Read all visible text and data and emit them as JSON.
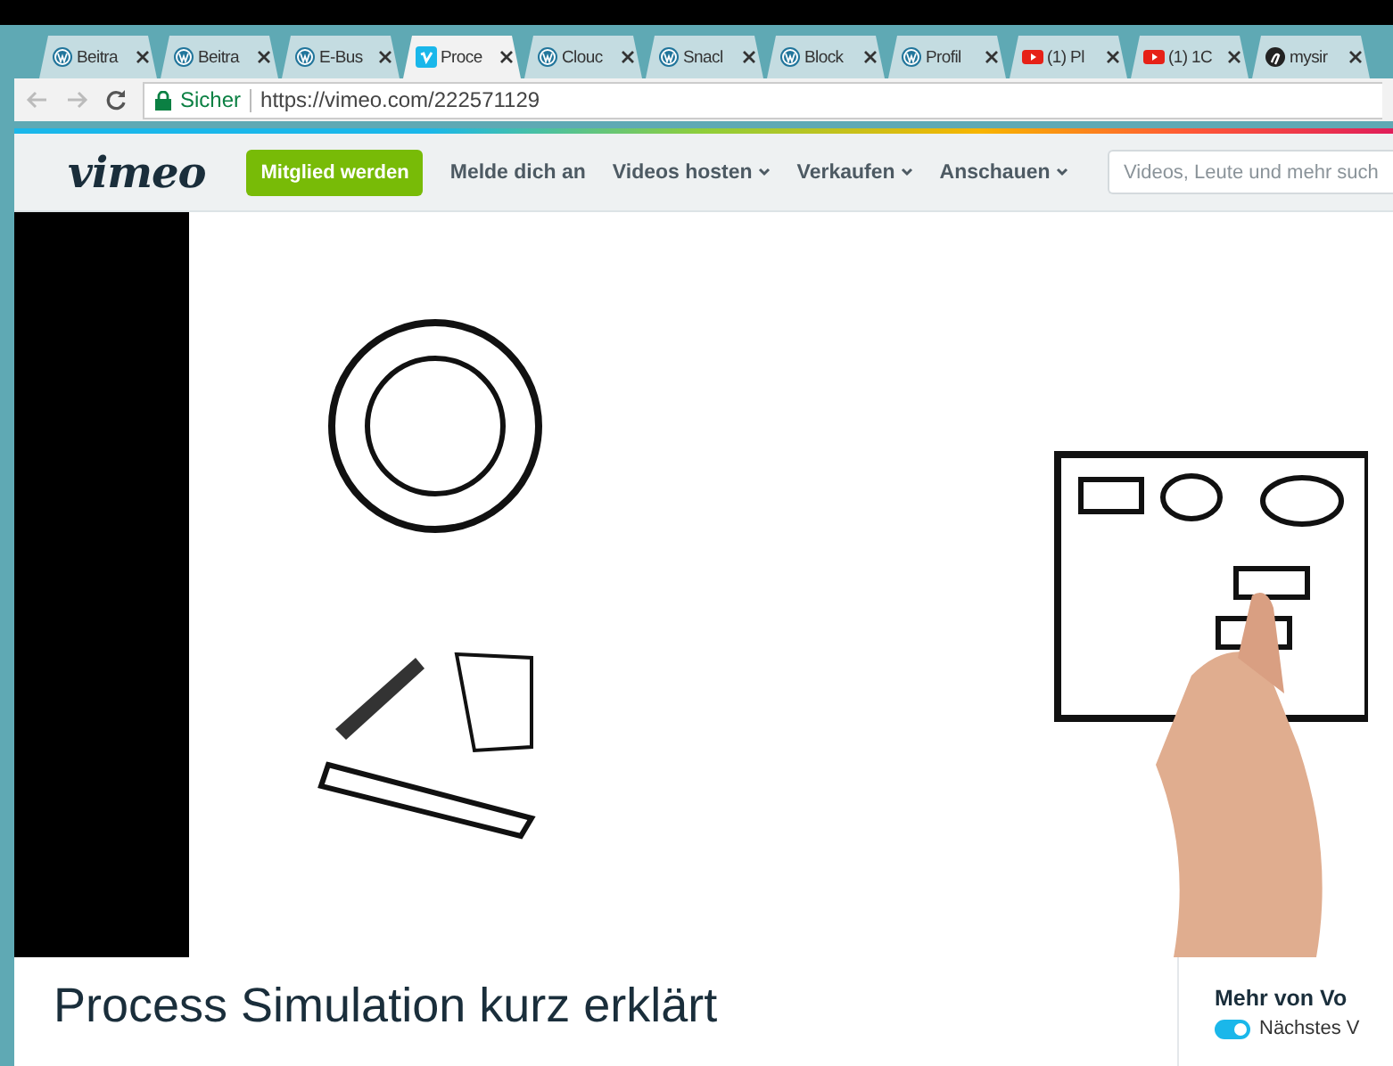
{
  "tabs": [
    {
      "kind": "wordpress",
      "label": "Beitra",
      "selected": false
    },
    {
      "kind": "wordpress",
      "label": "Beitra",
      "selected": false
    },
    {
      "kind": "wordpress",
      "label": "E-Bus",
      "selected": false
    },
    {
      "kind": "vimeo",
      "label": "Proce",
      "selected": true
    },
    {
      "kind": "wordpress",
      "label": "Clouc",
      "selected": false
    },
    {
      "kind": "wordpress",
      "label": "Snacl",
      "selected": false
    },
    {
      "kind": "wordpress",
      "label": "Block",
      "selected": false
    },
    {
      "kind": "wordpress",
      "label": "Profil",
      "selected": false
    },
    {
      "kind": "youtube",
      "label": "(1) Pl",
      "selected": false
    },
    {
      "kind": "youtube",
      "label": "(1) 1C",
      "selected": false
    },
    {
      "kind": "octocat",
      "label": "mysir",
      "selected": false
    }
  ],
  "address_bar": {
    "security": "Sicher",
    "url": "https://vimeo.com/222571129"
  },
  "site_header": {
    "logo": "vimeo",
    "join_button": "Mitglied werden",
    "login_link": "Melde dich an",
    "menus": [
      "Videos hosten",
      "Verkaufen",
      "Anschauen"
    ],
    "search": {
      "placeholder": "Videos, Leute und mehr such"
    }
  },
  "video_title": "Process Simulation kurz erklärt",
  "sidebar": {
    "heading": "Mehr von Vo",
    "autoplay": {
      "label": "Nächstes V",
      "on": true
    }
  }
}
